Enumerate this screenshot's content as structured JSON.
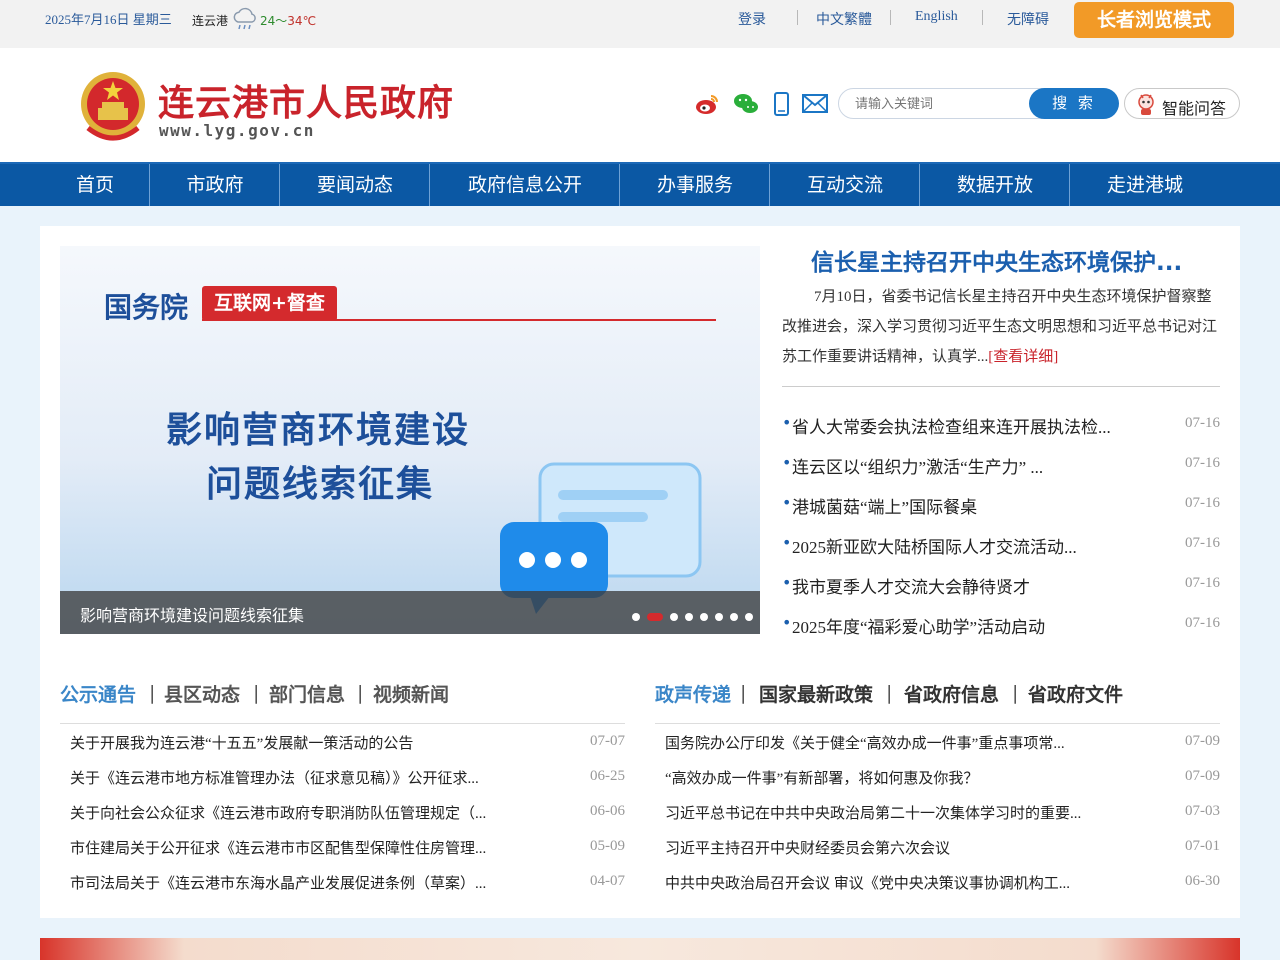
{
  "topbar": {
    "date": "2025年7月16日 星期三",
    "city": "连云港",
    "weather_icon": "rain-cloud-icon",
    "temp_low": "24",
    "temp_sep": "～",
    "temp_high": "34℃",
    "links": [
      "登录",
      "中文繁體",
      "English",
      "无障碍"
    ],
    "elder_mode": "长者浏览模式"
  },
  "header": {
    "title": "连云港市人民政府",
    "url": "www.lyg.gov.cn",
    "social_icons": [
      "weibo-icon",
      "wechat-icon",
      "mobile-icon",
      "mail-icon"
    ],
    "search_placeholder": "请输入关键词",
    "search_button": "搜 索",
    "ai_button": "智能问答"
  },
  "nav": [
    "首页",
    "市政府",
    "要闻动态",
    "政府信息公开",
    "办事服务",
    "互动交流",
    "数据开放",
    "走进港城"
  ],
  "slide": {
    "title": "国务院",
    "tag": "互联网+督查",
    "line1": "影响营商环境建设",
    "line2": "问题线索征集",
    "caption": "影响营商环境建设问题线索征集",
    "dot_count": 8,
    "active_dot": 2
  },
  "headline": {
    "title": "信长星主持召开中央生态环境保护...",
    "summary": "7月10日，省委书记信长星主持召开中央生态环境保护督察整改推进会，深入学习贯彻习近平生态文明思想和习近平总书记对江苏工作重要讲话精神，认真学...",
    "more": "[查看详细]"
  },
  "news": [
    {
      "title": "省人大常委会执法检查组来连开展执法检...",
      "date": "07-16"
    },
    {
      "title": "连云区以“组织力”激活“生产力” ...",
      "date": "07-16"
    },
    {
      "title": "港城菌菇“端上”国际餐桌",
      "date": "07-16"
    },
    {
      "title": "2025新亚欧大陆桥国际人才交流活动...",
      "date": "07-16"
    },
    {
      "title": "我市夏季人才交流大会静待贤才",
      "date": "07-16"
    },
    {
      "title": "2025年度“福彩爱心助学”活动启动",
      "date": "07-16"
    }
  ],
  "left_block": {
    "tabs": [
      "公示通告",
      "县区动态",
      "部门信息",
      "视频新闻"
    ],
    "sep": "|",
    "items": [
      {
        "title": "关于开展我为连云港“十五五”发展献一策活动的公告",
        "date": "07-07"
      },
      {
        "title": "关于《连云港市地方标准管理办法（征求意见稿）》公开征求...",
        "date": "06-25"
      },
      {
        "title": "关于向社会公众征求《连云港市政府专职消防队伍管理规定（...",
        "date": "06-06"
      },
      {
        "title": "市住建局关于公开征求《连云港市市区配售型保障性住房管理...",
        "date": "05-09"
      },
      {
        "title": "市司法局关于《连云港市东海水晶产业发展促进条例（草案）...",
        "date": "04-07"
      }
    ]
  },
  "right_block": {
    "tabs": [
      "政声传递",
      "国家最新政策",
      "省政府信息",
      "省政府文件"
    ],
    "sep": "|",
    "items": [
      {
        "title": "国务院办公厅印发《关于健全“高效办成一件事”重点事项常...",
        "date": "07-09"
      },
      {
        "title": "“高效办成一件事”有新部署，将如何惠及你我？",
        "date": "07-09"
      },
      {
        "title": "习近平总书记在中共中央政治局第二十一次集体学习时的重要...",
        "date": "07-03"
      },
      {
        "title": "习近平主持召开中央财经委员会第六次会议",
        "date": "07-01"
      },
      {
        "title": "中共中央政治局召开会议 审议《党中央决策议事协调机构工...",
        "date": "06-30"
      }
    ]
  },
  "colors": {
    "nav_bg": "#0b58a4",
    "title_red": "#c9232b",
    "accent_blue": "#1b76c5",
    "elder_orange": "#f29a27"
  }
}
